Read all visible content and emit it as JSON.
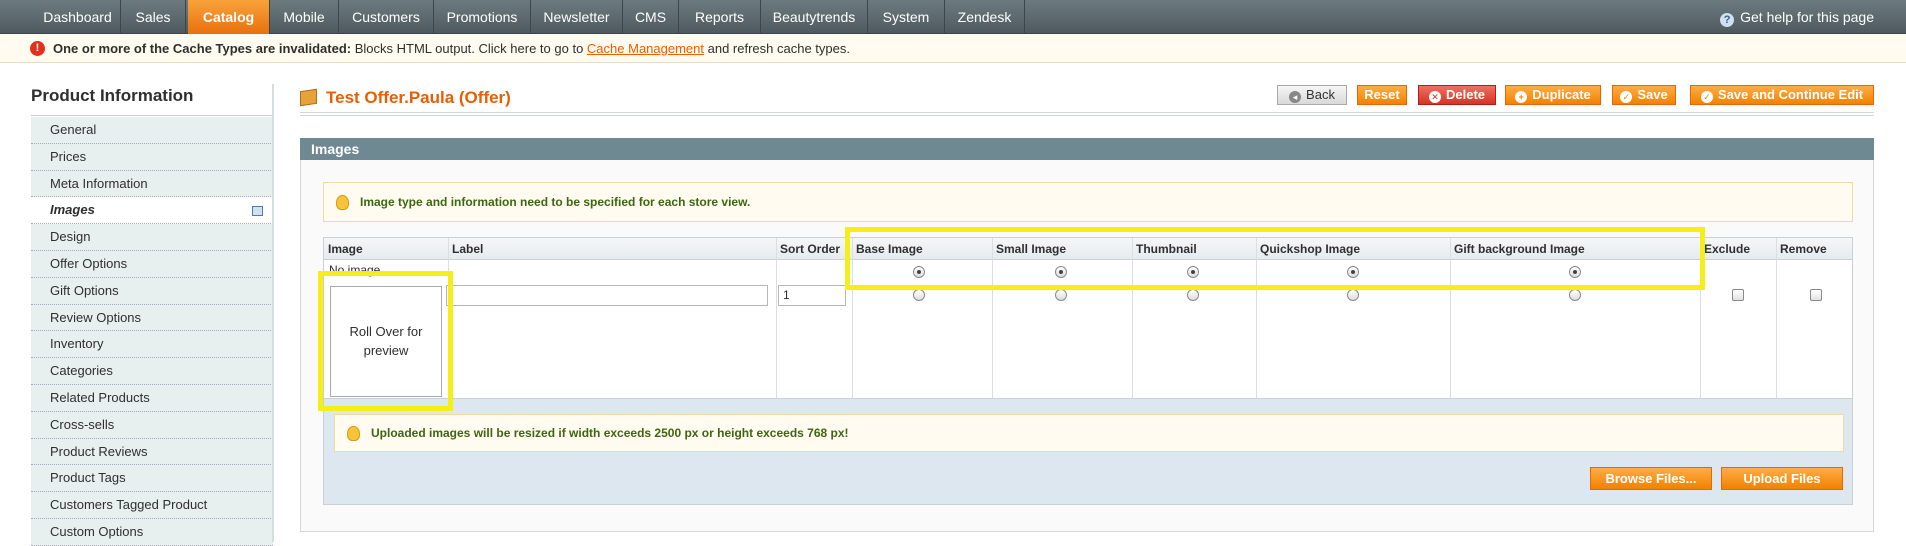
{
  "nav": {
    "items": [
      "Dashboard",
      "Sales",
      "Catalog",
      "Mobile",
      "Customers",
      "Promotions",
      "Newsletter",
      "CMS",
      "Reports",
      "Beautytrends",
      "System",
      "Zendesk"
    ],
    "active": "Catalog",
    "help": "Get help for this page"
  },
  "message": {
    "bold": "One or more of the Cache Types are invalidated:",
    "text": " Blocks HTML output. Click here to go to ",
    "link": "Cache Management",
    "tail": " and refresh cache types."
  },
  "sidebar": {
    "title": "Product Information",
    "items": [
      "General",
      "Prices",
      "Meta Information",
      "Images",
      "Design",
      "Offer Options",
      "Gift Options",
      "Review Options",
      "Inventory",
      "Categories",
      "Related Products",
      "Cross-sells",
      "Product Reviews",
      "Product Tags",
      "Customers Tagged Product",
      "Custom Options"
    ],
    "active": "Images"
  },
  "page": {
    "title": "Test Offer.Paula (Offer)",
    "buttons": {
      "back": "Back",
      "reset": "Reset",
      "delete": "Delete",
      "duplicate": "Duplicate",
      "save": "Save",
      "save_continue": "Save and Continue Edit"
    }
  },
  "section": {
    "title": "Images",
    "notice": "Image type and information need to be specified for each store view.",
    "columns": [
      "Image",
      "Label",
      "Sort Order",
      "Base Image",
      "Small Image",
      "Thumbnail",
      "Quickshop Image",
      "Gift background Image",
      "Exclude",
      "Remove"
    ],
    "no_image": "No image",
    "preview": "Roll Over for preview",
    "label_value": "",
    "sort_value": "1",
    "upload_notice": "Uploaded images will be resized if width exceeds 2500 px or height exceeds 768 px!",
    "browse": "Browse Files...",
    "upload": "Upload Files"
  },
  "colors": {
    "accent": "#eb5e00",
    "highlight": "#f5ee18",
    "section_head": "#6f8992"
  }
}
